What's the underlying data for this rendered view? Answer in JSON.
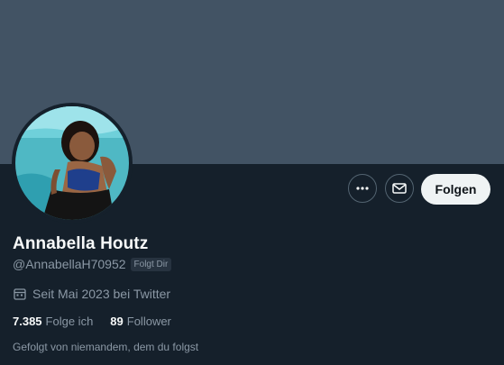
{
  "profile": {
    "name": "Annabella Houtz",
    "handle": "@AnnabellaH70952",
    "follows_you_badge": "Folgt Dir",
    "joined": "Seit Mai 2023 bei Twitter",
    "following_count": "7.385",
    "following_label": "Folge ich",
    "followers_count": "89",
    "followers_label": "Follower",
    "followed_by_text": "Gefolgt von niemandem, dem du folgst"
  },
  "actions": {
    "more_icon": "more-horizontal-icon",
    "message_icon": "envelope-icon",
    "follow_label": "Folgen"
  },
  "icons": {
    "joined_icon": "calendar-icon"
  },
  "colors": {
    "background": "#15202b",
    "banner": "#425364",
    "text_primary": "#f7f9f9",
    "text_secondary": "#8b98a5",
    "follow_button_bg": "#eff3f4"
  }
}
